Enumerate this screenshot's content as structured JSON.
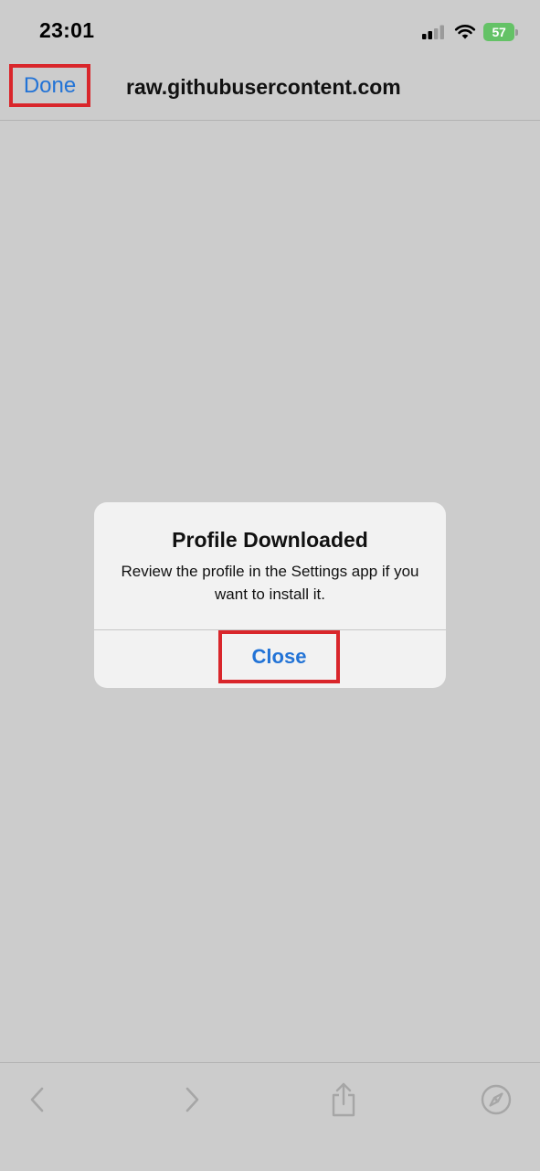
{
  "status_bar": {
    "time": "23:01",
    "battery_level": "57",
    "icons": [
      "signal-icon",
      "wifi-icon",
      "battery-icon"
    ]
  },
  "header": {
    "done_label": "Done",
    "title": "raw.githubusercontent.com"
  },
  "alert": {
    "title": "Profile Downloaded",
    "message": "Review the profile in the Settings app if you want to install it.",
    "close_label": "Close"
  },
  "toolbar": {
    "icons": [
      "back-icon",
      "forward-icon",
      "share-icon",
      "compass-icon"
    ]
  },
  "colors": {
    "background": "#cccccc",
    "accent": "#2273d6",
    "highlight": "#d9262b",
    "battery": "#64c266",
    "alert_bg": "#f2f2f2"
  }
}
